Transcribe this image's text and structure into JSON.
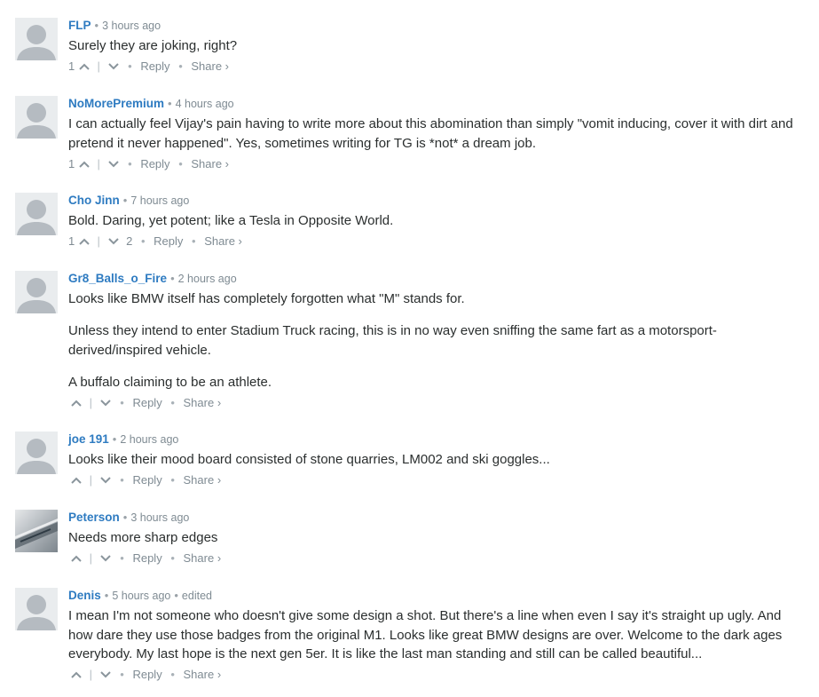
{
  "comments": [
    {
      "author": "FLP",
      "time": "3 hours ago",
      "edited": "",
      "paragraphs": [
        "Surely they are joking, right?"
      ],
      "upvotes": "1",
      "downvotes": "",
      "reply": "Reply",
      "share": "Share ›"
    },
    {
      "author": "NoMorePremium",
      "time": "4 hours ago",
      "edited": "",
      "paragraphs": [
        "I can actually feel Vijay's pain having to write more about this abomination than simply \"vomit inducing, cover it with dirt and pretend it never happened\". Yes, sometimes writing for TG is *not* a dream job."
      ],
      "upvotes": "1",
      "downvotes": "",
      "reply": "Reply",
      "share": "Share ›"
    },
    {
      "author": "Cho Jinn",
      "time": "7 hours ago",
      "edited": "",
      "paragraphs": [
        "Bold. Daring, yet potent; like a Tesla in Opposite World."
      ],
      "upvotes": "1",
      "downvotes": "2",
      "reply": "Reply",
      "share": "Share ›"
    },
    {
      "author": "Gr8_Balls_o_Fire",
      "time": "2 hours ago",
      "edited": "",
      "paragraphs": [
        "Looks like BMW itself has completely forgotten what \"M\" stands for.",
        "Unless they intend to enter Stadium Truck racing, this is in no way even sniffing the same fart as a motorsport-derived/inspired vehicle.",
        "A buffalo claiming to be an athlete."
      ],
      "upvotes": "",
      "downvotes": "",
      "reply": "Reply",
      "share": "Share ›"
    },
    {
      "author": "joe 191",
      "time": "2 hours ago",
      "edited": "",
      "paragraphs": [
        "Looks like their mood board consisted of stone quarries, LM002 and ski goggles..."
      ],
      "upvotes": "",
      "downvotes": "",
      "reply": "Reply",
      "share": "Share ›"
    },
    {
      "author": "Peterson",
      "time": "3 hours ago",
      "edited": "",
      "paragraphs": [
        "Needs more sharp edges"
      ],
      "upvotes": "",
      "downvotes": "",
      "reply": "Reply",
      "share": "Share ›"
    },
    {
      "author": "Denis",
      "time": "5 hours ago",
      "edited": "edited",
      "paragraphs": [
        "I mean I'm not someone who doesn't give some design a shot. But there's a line when even I say it's straight up ugly. And how dare they use those badges from the original M1. Looks like great BMW designs are over. Welcome to the dark ages everybody. My last hope is the next gen 5er. It is like the last man standing and still can be called beautiful..."
      ],
      "upvotes": "",
      "downvotes": "",
      "reply": "Reply",
      "share": "Share ›"
    }
  ],
  "colors": {
    "author": "#2e7bc1",
    "muted": "#7f8b93",
    "text": "#2a2e2e",
    "avatar": "#b5bbc1"
  },
  "icons": {
    "upvote": "chevron-up-icon",
    "downvote": "chevron-down-icon",
    "avatar": "default-avatar-icon"
  }
}
